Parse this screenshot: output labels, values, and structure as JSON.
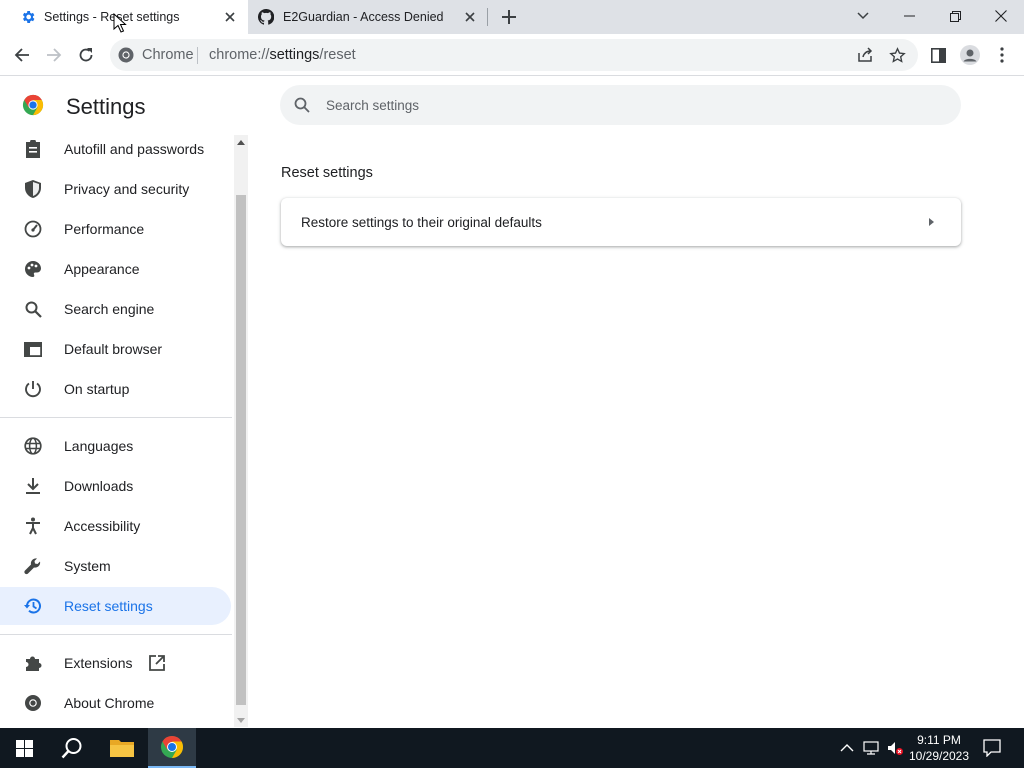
{
  "browser": {
    "tabs": [
      {
        "title": "Settings - Reset settings",
        "icon": "gear-icon",
        "active": true
      },
      {
        "title": "E2Guardian - Access Denied",
        "icon": "github-icon",
        "active": false
      }
    ],
    "omnibox": {
      "site_name": "Chrome",
      "url_scheme": "chrome://",
      "url_host": "settings",
      "url_path": "/reset"
    }
  },
  "settings": {
    "title": "Settings",
    "search_placeholder": "Search settings",
    "nav": {
      "autofill": "Autofill and passwords",
      "privacy": "Privacy and security",
      "performance": "Performance",
      "appearance": "Appearance",
      "search_engine": "Search engine",
      "default_browser": "Default browser",
      "on_startup": "On startup",
      "languages": "Languages",
      "downloads": "Downloads",
      "accessibility": "Accessibility",
      "system": "System",
      "reset": "Reset settings",
      "extensions": "Extensions",
      "about": "About Chrome"
    },
    "selected_nav": "reset",
    "section_title": "Reset settings",
    "restore_row_label": "Restore settings to their original defaults"
  },
  "taskbar": {
    "time": "9:11 PM",
    "date": "10/29/2023"
  },
  "colors": {
    "accent": "#1a73e8",
    "selected_bg": "#e8f0fe",
    "tabstrip_bg": "#dee1e6",
    "taskbar_bg": "#101820"
  }
}
